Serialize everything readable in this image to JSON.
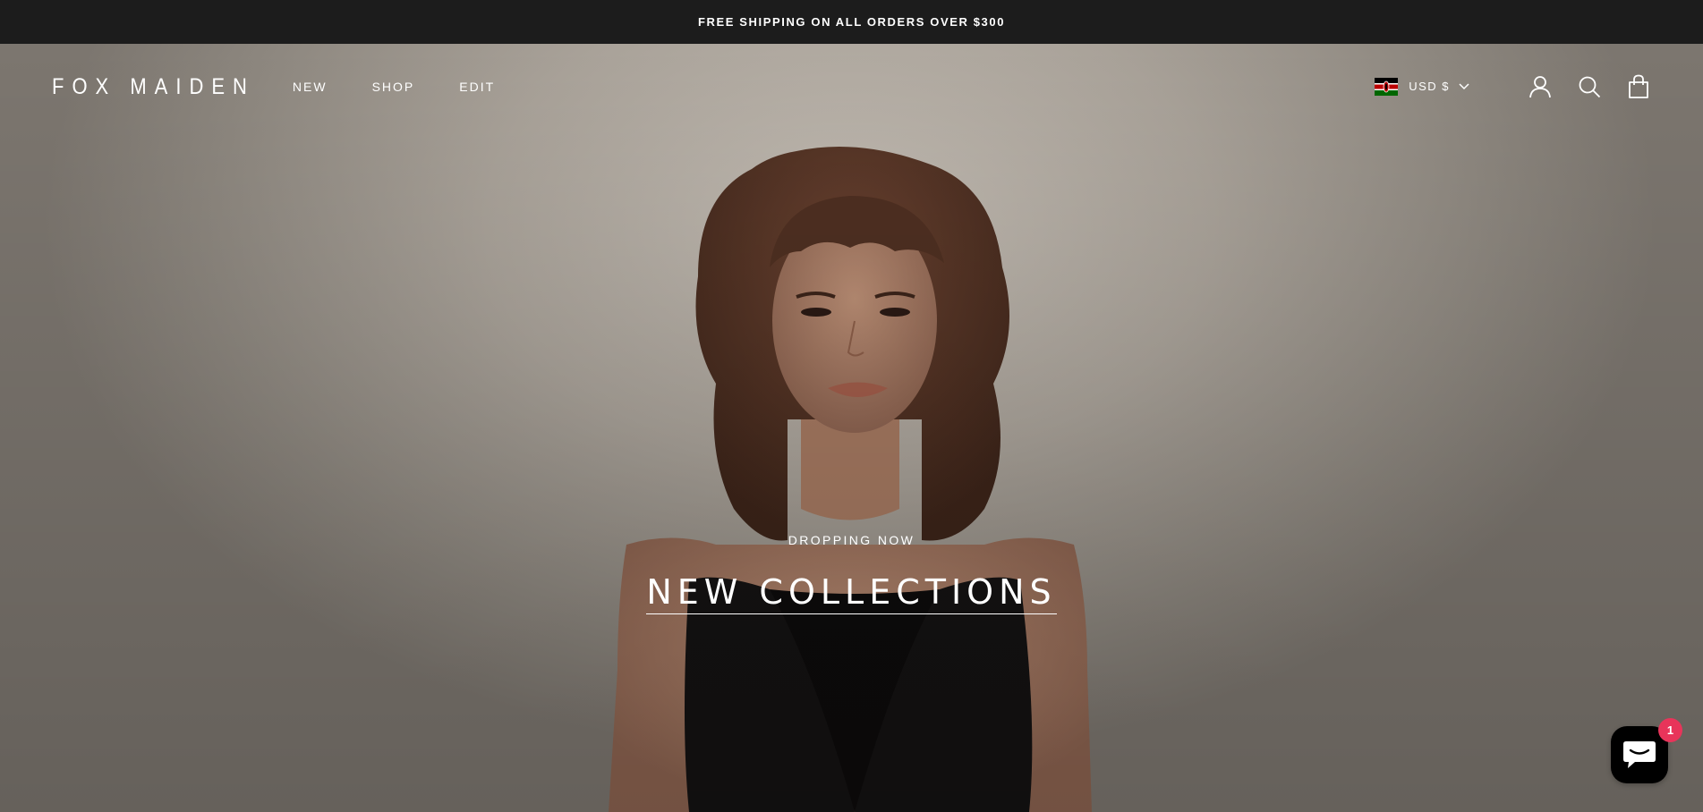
{
  "announcement": {
    "text": "FREE SHIPPING ON ALL ORDERS OVER $300"
  },
  "header": {
    "logo": "FOX MAIDEN",
    "nav": [
      {
        "label": "NEW"
      },
      {
        "label": "SHOP"
      },
      {
        "label": "EDIT"
      }
    ],
    "currency": {
      "label": "USD $",
      "flag": "kenya-flag"
    },
    "icons": [
      "account-icon",
      "search-icon",
      "cart-icon"
    ]
  },
  "hero": {
    "eyebrow": "DROPPING NOW",
    "headline": "NEW COLLECTIONS"
  },
  "chat": {
    "badge_count": "1",
    "icon": "chat-bubble-icon"
  },
  "colors": {
    "announcement_bg": "#1c1c1c",
    "chat_bg": "#000000",
    "badge": "#e8345a",
    "text": "#ffffff"
  }
}
